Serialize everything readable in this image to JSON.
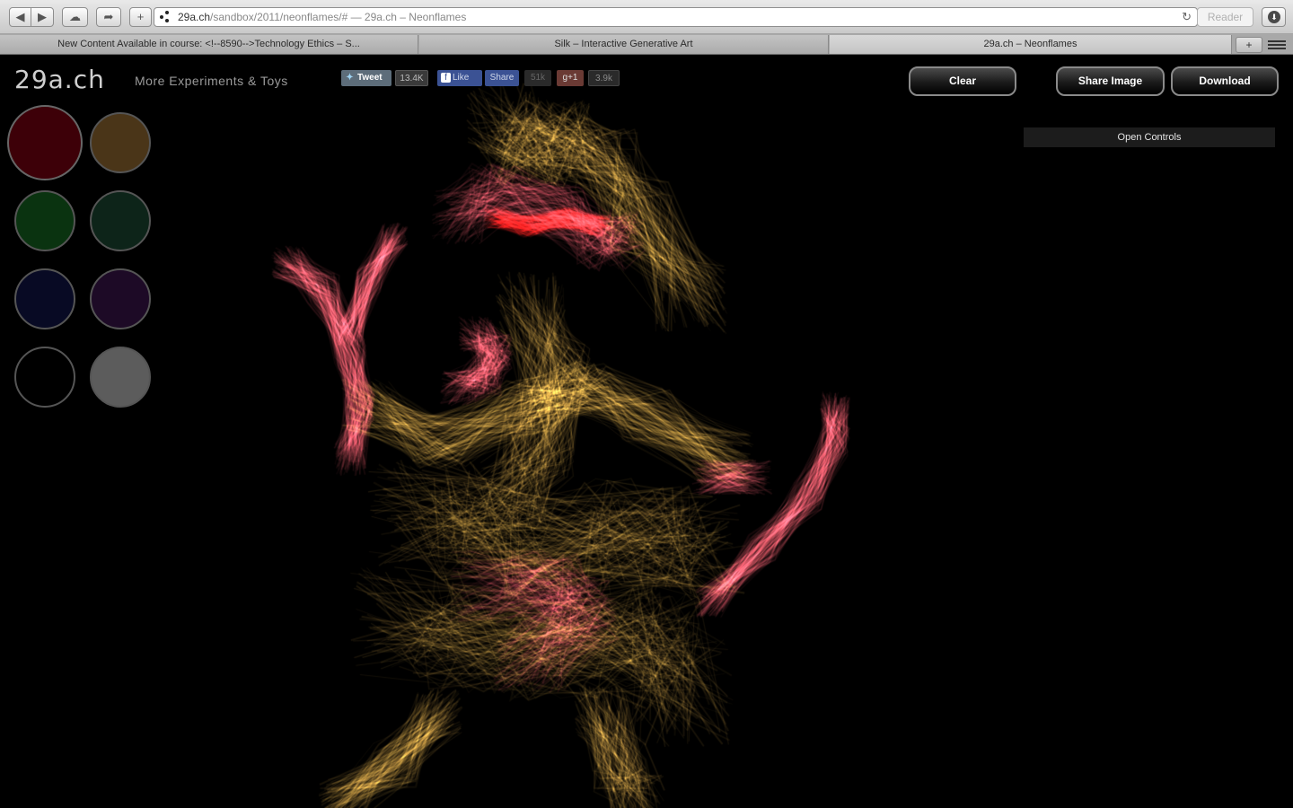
{
  "browser": {
    "url_host": "29a.ch",
    "url_path": "/sandbox/2011/neonflames/#",
    "url_suffix": " — 29a.ch – Neonflames",
    "reader_label": "Reader",
    "tabs": [
      {
        "title": "New Content Available in course: <!--8590-->Technology Ethics – S..."
      },
      {
        "title": "Silk – Interactive Generative Art"
      },
      {
        "title": "29a.ch – Neonflames"
      }
    ]
  },
  "page": {
    "logo": "29a.ch",
    "more_link": "More Experiments & Toys",
    "social": {
      "tweet_label": "Tweet",
      "tweet_count": "13.4K",
      "like_label": "Like",
      "share_label": "Share",
      "fb_count": "51k",
      "gplus_label": "+1",
      "gplus_count": "3.9k"
    },
    "buttons": {
      "clear": "Clear",
      "share_image": "Share Image",
      "download": "Download"
    },
    "open_controls": "Open Controls",
    "palette": [
      {
        "name": "dark-red",
        "color": "#3d0008",
        "selected": true
      },
      {
        "name": "brown",
        "color": "#4a3518"
      },
      {
        "name": "dark-green",
        "color": "#0a3310"
      },
      {
        "name": "dark-teal",
        "color": "#0d2419"
      },
      {
        "name": "dark-navy",
        "color": "#080a24"
      },
      {
        "name": "dark-purple",
        "color": "#1d0a26"
      },
      {
        "name": "black",
        "color": "#000000"
      },
      {
        "name": "gray",
        "color": "#5c5c5c"
      }
    ],
    "flame_colors": {
      "gold": "#e8b34a",
      "pink": "#ee5a6a",
      "red": "#ff1a1a"
    }
  }
}
